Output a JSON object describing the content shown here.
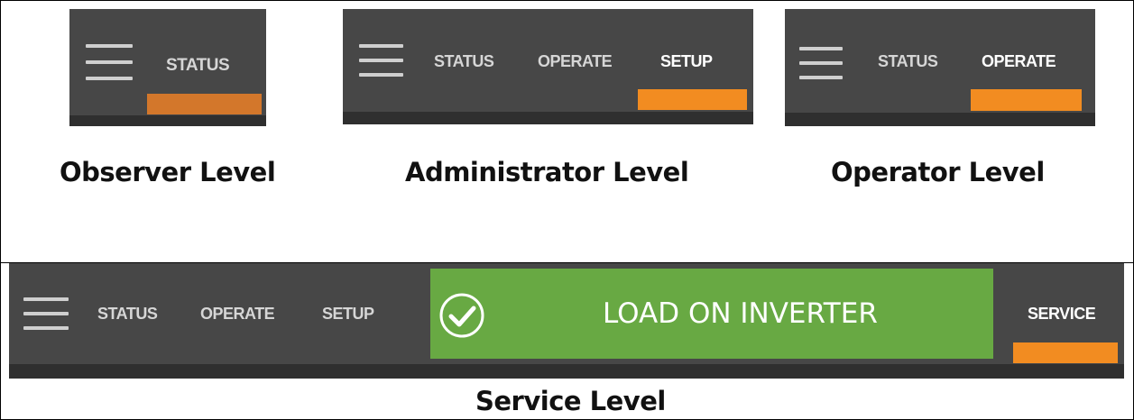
{
  "colors": {
    "bar": "#474747",
    "bar_strip": "#2f2f2f",
    "accent_orange": "#f28c21",
    "accent_orange_dim": "#d3772b",
    "status_green": "#68a943"
  },
  "panels": {
    "observer": {
      "tabs": [
        {
          "label": "STATUS",
          "active": false
        }
      ],
      "caption": "Observer Level"
    },
    "administrator": {
      "tabs": [
        {
          "label": "STATUS",
          "active": false
        },
        {
          "label": "OPERATE",
          "active": false
        },
        {
          "label": "SETUP",
          "active": true
        }
      ],
      "caption": "Administrator Level"
    },
    "operator": {
      "tabs": [
        {
          "label": "STATUS",
          "active": false
        },
        {
          "label": "OPERATE",
          "active": true
        }
      ],
      "caption": "Operator Level"
    },
    "service": {
      "tabs": [
        {
          "label": "STATUS",
          "active": false
        },
        {
          "label": "OPERATE",
          "active": false
        },
        {
          "label": "SETUP",
          "active": false
        },
        {
          "label": "SERVICE",
          "active": true
        }
      ],
      "status_banner": {
        "text": "LOAD ON INVERTER",
        "icon": "check-circle-icon"
      },
      "caption": "Service Level"
    }
  },
  "icons": {
    "menu": "hamburger-menu-icon"
  }
}
